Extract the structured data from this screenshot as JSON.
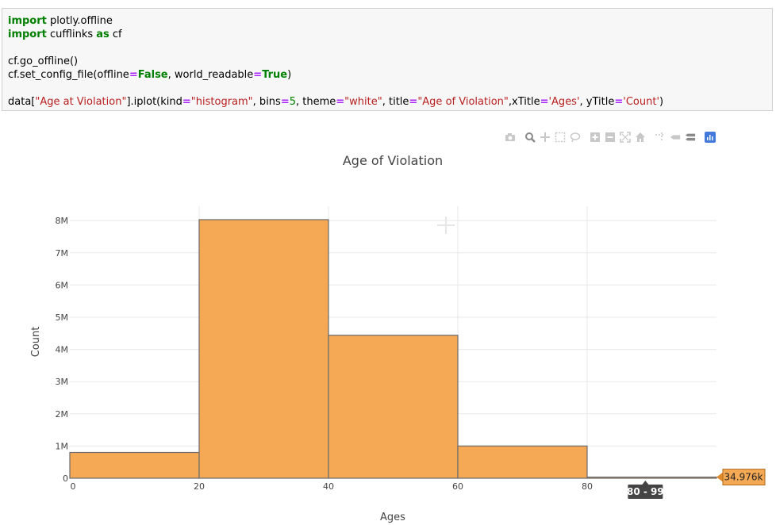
{
  "code": {
    "line1": {
      "kw": "import",
      "rest": " plotly.offline"
    },
    "line2": {
      "kw1": "import",
      "mid": " cufflinks ",
      "kw2": "as",
      "rest": " cf"
    },
    "line3": "cf.go_offline()",
    "line4": {
      "a": "cf.set_config_file(offline",
      "eq1": "=",
      "v1": "False",
      "b": ", world_readable",
      "eq2": "=",
      "v2": "True",
      "c": ")"
    },
    "line5": {
      "a": "data[",
      "s1": "\"Age at Violation\"",
      "b": "].iplot(kind",
      "eq1": "=",
      "s2": "\"histogram\"",
      "c": ", bins",
      "eq2": "=",
      "n1": "5",
      "d": ", theme",
      "eq3": "=",
      "s3": "\"white\"",
      "e": ", title",
      "eq4": "=",
      "s4": "\"Age of Violation\"",
      "f": ",xTitle",
      "eq5": "=",
      "s5": "'Ages'",
      "g": ", yTitle",
      "eq6": "=",
      "s6": "'Count'",
      "h": ")"
    }
  },
  "modebar": {
    "icons": [
      "camera-icon",
      "zoom-icon",
      "pan-icon",
      "box-select-icon",
      "lasso-icon",
      "zoom-in-icon",
      "zoom-out-icon",
      "autoscale-icon",
      "home-icon",
      "spike-lines-icon",
      "hover-closest-icon",
      "hover-compare-icon",
      "plotly-logo-icon"
    ]
  },
  "chart_data": {
    "type": "bar",
    "title": "Age of Violation",
    "xlabel": "Ages",
    "ylabel": "Count",
    "bins": [
      {
        "start": 0,
        "end": 20,
        "value": 800000
      },
      {
        "start": 20,
        "end": 40,
        "value": 8030000
      },
      {
        "start": 40,
        "end": 60,
        "value": 4440000
      },
      {
        "start": 60,
        "end": 80,
        "value": 1000000
      },
      {
        "start": 80,
        "end": 100,
        "value": 34976
      }
    ],
    "xlim": [
      0,
      100
    ],
    "ylim": [
      0,
      8300000
    ],
    "x_ticks": [
      0,
      20,
      40,
      60,
      80
    ],
    "y_ticks": [
      {
        "value": 0,
        "label": "0"
      },
      {
        "value": 1000000,
        "label": "1M"
      },
      {
        "value": 2000000,
        "label": "2M"
      },
      {
        "value": 3000000,
        "label": "3M"
      },
      {
        "value": 4000000,
        "label": "4M"
      },
      {
        "value": 5000000,
        "label": "5M"
      },
      {
        "value": 6000000,
        "label": "6M"
      },
      {
        "value": 7000000,
        "label": "7M"
      },
      {
        "value": 8000000,
        "label": "8M"
      }
    ],
    "bar_color": "#f5a955",
    "bar_edge": "#6b6b6b",
    "grid": true,
    "hover": {
      "x_label": "80 - 99",
      "y_label": "34.976k",
      "bin_index": 4
    }
  }
}
